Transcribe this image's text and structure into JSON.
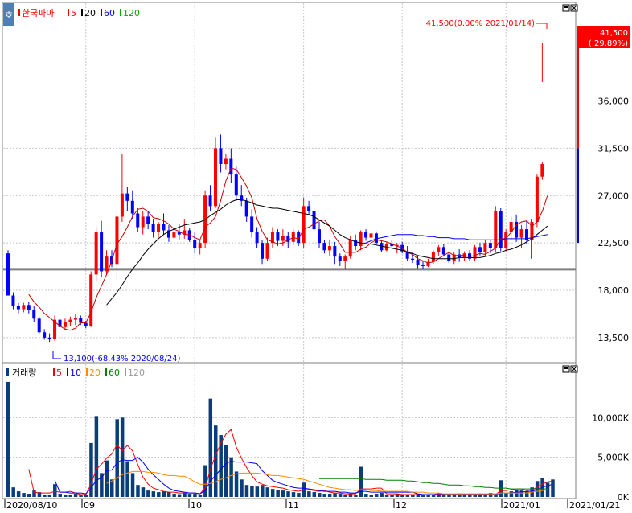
{
  "price_panel": {
    "icon_label": "호",
    "stock_name": "한국파마",
    "ma_labels": [
      {
        "text": "5",
        "color": "#ff0000"
      },
      {
        "text": "20",
        "color": "#000000"
      },
      {
        "text": "60",
        "color": "#0000ff"
      },
      {
        "text": "120",
        "color": "#00aa00"
      }
    ],
    "max_annotation": "41,500(0.00% 2021/01/14)",
    "min_annotation": "13,100(-68.43% 2020/08/24)",
    "current_price": "41,500",
    "current_change": "( 29.89%)",
    "y_ticks": [
      "36,000",
      "31,500",
      "27,000",
      "22,500",
      "18,000",
      "13,500"
    ]
  },
  "volume_panel": {
    "title": "거래량",
    "ma_labels": [
      {
        "text": "5",
        "color": "#ff0000"
      },
      {
        "text": "10",
        "color": "#0000ff"
      },
      {
        "text": "20",
        "color": "#ff8c00"
      },
      {
        "text": "60",
        "color": "#008000"
      },
      {
        "text": "120",
        "color": "#999999"
      }
    ],
    "y_ticks": [
      "10,000K",
      "5,000K",
      "0K"
    ]
  },
  "x_axis": {
    "labels": [
      "2020/08/10",
      "09",
      "10",
      "11",
      "12",
      "2021/01",
      "2021/01/21"
    ]
  },
  "colors": {
    "up": "#ff0000",
    "down": "#0000ff",
    "volume": "#0a3d7a",
    "grid": "#c8c8c8",
    "horizontal_line": "#808080"
  },
  "chart_data": {
    "type": "candlestick",
    "y_range": [
      11500,
      43000
    ],
    "horizontal_line": 20000,
    "candles": [
      [
        21500,
        21800,
        17500,
        17500
      ],
      [
        17500,
        17800,
        16200,
        16500
      ],
      [
        16500,
        16800,
        15800,
        16200
      ],
      [
        16200,
        16800,
        15900,
        16600
      ],
      [
        16600,
        16900,
        15800,
        16100
      ],
      [
        16100,
        16500,
        15000,
        15300
      ],
      [
        15300,
        15500,
        13800,
        14000
      ],
      [
        14000,
        14300,
        13300,
        13500
      ],
      [
        13500,
        13900,
        13100,
        13400
      ],
      [
        13400,
        15600,
        13200,
        15200
      ],
      [
        15200,
        15400,
        14300,
        14500
      ],
      [
        14500,
        15300,
        14200,
        15000
      ],
      [
        15000,
        15500,
        14600,
        15200
      ],
      [
        15200,
        15700,
        14700,
        15400
      ],
      [
        15400,
        15600,
        14700,
        14900
      ],
      [
        14900,
        15100,
        14400,
        14600
      ],
      [
        14600,
        19800,
        14500,
        19500
      ],
      [
        19500,
        24000,
        18800,
        23500
      ],
      [
        23500,
        24600,
        19300,
        19800
      ],
      [
        19800,
        21800,
        19500,
        21200
      ],
      [
        21200,
        21800,
        20200,
        20500
      ],
      [
        20500,
        25500,
        19000,
        25000
      ],
      [
        25000,
        31000,
        24500,
        27200
      ],
      [
        27200,
        27800,
        25500,
        26500
      ],
      [
        26500,
        27500,
        24800,
        25300
      ],
      [
        25300,
        25800,
        23500,
        24000
      ],
      [
        24000,
        25500,
        23300,
        25000
      ],
      [
        25000,
        25500,
        23800,
        24300
      ],
      [
        24300,
        24800,
        23000,
        23500
      ],
      [
        23500,
        24500,
        23000,
        24300
      ],
      [
        24300,
        25300,
        23300,
        23700
      ],
      [
        23700,
        24200,
        22600,
        23000
      ],
      [
        23000,
        24000,
        22800,
        23500
      ],
      [
        23500,
        24300,
        22800,
        23300
      ],
      [
        23300,
        24800,
        22900,
        23700
      ],
      [
        23700,
        23900,
        22600,
        22800
      ],
      [
        22800,
        23500,
        21500,
        22000
      ],
      [
        22000,
        22800,
        21400,
        22500
      ],
      [
        22500,
        27500,
        22000,
        27000
      ],
      [
        27000,
        28000,
        25500,
        26000
      ],
      [
        26000,
        32500,
        25800,
        31500
      ],
      [
        31500,
        32800,
        29200,
        30000
      ],
      [
        30000,
        31000,
        29500,
        30500
      ],
      [
        30500,
        31500,
        28200,
        29000
      ],
      [
        29000,
        29800,
        26500,
        27000
      ],
      [
        27000,
        28000,
        26000,
        26500
      ],
      [
        26500,
        26800,
        24500,
        25000
      ],
      [
        25000,
        25700,
        23000,
        23500
      ],
      [
        23500,
        24000,
        22000,
        22500
      ],
      [
        22500,
        22800,
        20500,
        21000
      ],
      [
        21000,
        23000,
        20800,
        22500
      ],
      [
        22500,
        24000,
        22000,
        23500
      ],
      [
        23500,
        23800,
        22200,
        22700
      ],
      [
        22700,
        23800,
        22200,
        23200
      ],
      [
        23200,
        23500,
        22000,
        22600
      ],
      [
        22600,
        23800,
        22300,
        23500
      ],
      [
        23500,
        23700,
        22200,
        22500
      ],
      [
        22500,
        26800,
        22000,
        26000
      ],
      [
        26000,
        26500,
        25200,
        25500
      ],
      [
        25500,
        25800,
        23500,
        23800
      ],
      [
        23800,
        24500,
        22000,
        22500
      ],
      [
        22500,
        22800,
        21500,
        21800
      ],
      [
        21800,
        22800,
        21300,
        22200
      ],
      [
        22200,
        22600,
        20500,
        21200
      ],
      [
        21200,
        21500,
        20300,
        20800
      ],
      [
        20800,
        21400,
        20000,
        21200
      ],
      [
        21200,
        23200,
        21000,
        22800
      ],
      [
        22800,
        23300,
        21800,
        22200
      ],
      [
        22200,
        23700,
        21800,
        23500
      ],
      [
        23500,
        23800,
        22700,
        23000
      ],
      [
        23000,
        23700,
        22700,
        23400
      ],
      [
        23400,
        23600,
        22300,
        22500
      ],
      [
        22500,
        22700,
        21600,
        21800
      ],
      [
        21800,
        22600,
        21700,
        22400
      ],
      [
        22400,
        22800,
        22000,
        22200
      ],
      [
        22200,
        22500,
        21500,
        22300
      ],
      [
        22300,
        22600,
        21500,
        21700
      ],
      [
        21700,
        22200,
        20800,
        21000
      ],
      [
        21000,
        21600,
        20600,
        20900
      ],
      [
        20900,
        21300,
        20100,
        20400
      ],
      [
        20400,
        20800,
        20000,
        20300
      ],
      [
        20300,
        21000,
        20200,
        20700
      ],
      [
        20700,
        21800,
        20500,
        21600
      ],
      [
        21600,
        22300,
        21300,
        22100
      ],
      [
        22100,
        22400,
        21200,
        21400
      ],
      [
        21400,
        21600,
        20600,
        20800
      ],
      [
        20800,
        21600,
        20500,
        21400
      ],
      [
        21400,
        21900,
        20700,
        21100
      ],
      [
        21100,
        21700,
        20800,
        21500
      ],
      [
        21500,
        21800,
        20800,
        21000
      ],
      [
        21000,
        22300,
        20800,
        22100
      ],
      [
        22100,
        22500,
        21300,
        21600
      ],
      [
        21600,
        22800,
        21200,
        22500
      ],
      [
        22500,
        22800,
        21500,
        22000
      ],
      [
        22000,
        26000,
        21600,
        25500
      ],
      [
        25500,
        25800,
        21700,
        22000
      ],
      [
        22000,
        23800,
        21700,
        23500
      ],
      [
        23500,
        25000,
        22800,
        24500
      ],
      [
        24500,
        25200,
        22600,
        23000
      ],
      [
        23000,
        24200,
        22000,
        23800
      ],
      [
        23800,
        24700,
        22400,
        22800
      ],
      [
        22800,
        24800,
        21000,
        24500
      ],
      [
        24500,
        29000,
        24000,
        28800
      ],
      [
        28800,
        30200,
        28500,
        30000
      ]
    ],
    "last_candle_wick": [
      37800,
      41500
    ],
    "ma5": [
      null,
      null,
      null,
      null,
      17600,
      16900,
      16400,
      15800,
      15400,
      15000,
      14600,
      14300,
      14200,
      14400,
      14900,
      14900,
      15900,
      17300,
      18400,
      19500,
      20800,
      22400,
      23100,
      24000,
      25000,
      25700,
      25800,
      25500,
      24900,
      24800,
      24600,
      24300,
      23800,
      23600,
      23300,
      23300,
      23000,
      22800,
      24000,
      24400,
      25000,
      26500,
      28400,
      29600,
      29500,
      28700,
      27900,
      26800,
      24800,
      23600,
      22800,
      22600,
      22400,
      22500,
      22800,
      23000,
      22900,
      23800,
      24000,
      24300,
      24600,
      24700,
      24100,
      23100,
      22400,
      21600,
      21600,
      21600,
      21900,
      22100,
      22500,
      22800,
      22700,
      22600,
      22400,
      22200,
      22000,
      21600,
      21400,
      21000,
      20800,
      20600,
      20700,
      21000,
      21300,
      21600,
      21300,
      21300,
      21300,
      21200,
      21300,
      21500,
      21400,
      21700,
      22000,
      22900,
      22900,
      23500,
      24200,
      24500,
      24600,
      24100,
      24500,
      25500,
      27000
    ],
    "ma20": [
      null,
      null,
      null,
      null,
      null,
      null,
      null,
      null,
      null,
      null,
      null,
      null,
      null,
      null,
      null,
      null,
      null,
      null,
      null,
      16600,
      17200,
      17800,
      18500,
      19300,
      20000,
      20600,
      21300,
      21900,
      22400,
      22900,
      23300,
      23600,
      23800,
      24000,
      24200,
      24300,
      24400,
      24500,
      24700,
      25100,
      25400,
      25700,
      26100,
      26400,
      26600,
      26600,
      26500,
      26300,
      26100,
      26000,
      25900,
      25800,
      25800,
      25700,
      25600,
      25500,
      25400,
      25300,
      25200,
      25000,
      24700,
      24400,
      24100,
      23700,
      23300,
      23000,
      22800,
      22600,
      22500,
      22400,
      22400,
      22300,
      22200,
      22100,
      22000,
      21900,
      21800,
      21600,
      21500,
      21300,
      21200,
      21100,
      21000,
      21000,
      21000,
      21000,
      21000,
      21100,
      21100,
      21100,
      21100,
      21100,
      21200,
      21300,
      21500,
      21600,
      21800,
      21900,
      22100,
      22300,
      22600,
      22900,
      23300,
      23700,
      24100
    ],
    "ma60": [
      null,
      null,
      null,
      null,
      null,
      null,
      null,
      null,
      null,
      null,
      null,
      null,
      null,
      null,
      null,
      null,
      null,
      null,
      null,
      null,
      null,
      null,
      null,
      null,
      null,
      null,
      null,
      null,
      null,
      null,
      null,
      null,
      null,
      null,
      null,
      null,
      null,
      null,
      null,
      null,
      null,
      null,
      null,
      null,
      null,
      null,
      null,
      null,
      null,
      null,
      null,
      null,
      null,
      null,
      null,
      null,
      null,
      null,
      null,
      null,
      null,
      null,
      null,
      null,
      null,
      null,
      null,
      null,
      22400,
      22500,
      22700,
      22900,
      23000,
      23100,
      23200,
      23300,
      23300,
      23300,
      23300,
      23200,
      23200,
      23100,
      23100,
      23000,
      23000,
      23000,
      22900,
      22900,
      22900,
      22800,
      22800,
      22800,
      22800,
      22800,
      22800,
      22800,
      22900,
      22900,
      22900,
      22900,
      22900,
      23000,
      23100,
      23200,
      23300
    ],
    "volume_range": [
      0,
      15000
    ],
    "volumes": [
      14500,
      1200,
      700,
      500,
      400,
      800,
      600,
      300,
      300,
      1600,
      400,
      300,
      300,
      400,
      200,
      200,
      6800,
      10200,
      3000,
      4600,
      2200,
      9800,
      10000,
      4500,
      3000,
      1500,
      1200,
      800,
      700,
      600,
      700,
      600,
      400,
      350,
      500,
      400,
      400,
      300,
      4000,
      12400,
      9000,
      7800,
      6500,
      5000,
      3200,
      2200,
      1500,
      1400,
      1300,
      1500,
      1200,
      1000,
      900,
      800,
      700,
      600,
      500,
      1800,
      700,
      600,
      500,
      400,
      400,
      500,
      400,
      300,
      400,
      300,
      3800,
      400,
      300,
      400,
      500,
      300,
      300,
      400,
      300,
      300,
      300,
      400,
      300,
      300,
      300,
      500,
      300,
      300,
      300,
      400,
      300,
      400,
      300,
      400,
      300,
      500,
      300,
      2100,
      500,
      700,
      900,
      800,
      700,
      1200,
      2000,
      2400,
      1800,
      2200
    ],
    "vol_ma5": [
      null,
      null,
      null,
      null,
      3500,
      600,
      500,
      500,
      500,
      700,
      600,
      600,
      700,
      500,
      300,
      300,
      1600,
      3500,
      4100,
      4900,
      5400,
      6600,
      5800,
      6500,
      5800,
      4100,
      2500,
      1600,
      1100,
      900,
      700,
      600,
      600,
      500,
      500,
      500,
      500,
      400,
      1100,
      3500,
      5200,
      6700,
      7900,
      8500,
      6300,
      4900,
      3700,
      2700,
      1900,
      1600,
      1400,
      1300,
      1200,
      1100,
      900,
      800,
      700,
      900,
      900,
      800,
      700,
      800,
      600,
      500,
      500,
      400,
      400,
      400,
      1000,
      1000,
      1000,
      1100,
      1100,
      400,
      400,
      400,
      300,
      300,
      300,
      300,
      300,
      300,
      300,
      400,
      300,
      300,
      300,
      400,
      300,
      400,
      300,
      400,
      300,
      400,
      300,
      800,
      800,
      900,
      1000,
      1000,
      800,
      900,
      1200,
      1600,
      1900,
      2000
    ],
    "vol_ma10": [
      null,
      null,
      null,
      null,
      null,
      null,
      null,
      null,
      null,
      2100,
      600,
      600,
      500,
      500,
      500,
      400,
      1100,
      2100,
      2400,
      3300,
      3400,
      4300,
      4700,
      4600,
      4600,
      5000,
      4400,
      3500,
      2800,
      2200,
      1600,
      1100,
      800,
      700,
      600,
      500,
      500,
      400,
      800,
      2000,
      2700,
      3500,
      4200,
      4500,
      4400,
      4400,
      4400,
      4300,
      4200,
      3300,
      2700,
      2100,
      1800,
      1600,
      1400,
      1200,
      1100,
      1100,
      1000,
      900,
      800,
      700,
      700,
      700,
      600,
      600,
      500,
      500,
      700,
      700,
      600,
      600,
      600,
      600,
      600,
      600,
      600,
      600,
      600,
      400,
      300,
      300,
      300,
      300,
      300,
      300,
      300,
      400,
      300,
      300,
      300,
      300,
      300,
      400,
      300,
      500,
      500,
      500,
      600,
      600,
      700,
      700,
      900,
      1200,
      1400,
      1600
    ],
    "vol_ma20": [
      null,
      null,
      null,
      null,
      null,
      null,
      null,
      null,
      null,
      null,
      null,
      null,
      null,
      null,
      null,
      null,
      null,
      null,
      null,
      1700,
      2000,
      2400,
      2800,
      3000,
      3200,
      3200,
      3200,
      3100,
      3100,
      3000,
      2800,
      2700,
      2700,
      2600,
      2600,
      2300,
      1900,
      1600,
      1600,
      1700,
      1900,
      2200,
      2400,
      2700,
      2900,
      3000,
      3000,
      3000,
      3000,
      2900,
      2800,
      2700,
      2700,
      2600,
      2500,
      2400,
      2300,
      2200,
      2000,
      1800,
      1600,
      1400,
      1200,
      1100,
      1000,
      900,
      900,
      800,
      900,
      900,
      800,
      800,
      700,
      700,
      700,
      700,
      700,
      700,
      600,
      600,
      600,
      500,
      500,
      500,
      400,
      400,
      400,
      400,
      400,
      400,
      400,
      400,
      400,
      400,
      400,
      500,
      500,
      500,
      500,
      500,
      500,
      600,
      700,
      800,
      900
    ],
    "vol_ma60": [
      null,
      null,
      null,
      null,
      null,
      null,
      null,
      null,
      null,
      null,
      null,
      null,
      null,
      null,
      null,
      null,
      null,
      null,
      null,
      null,
      null,
      null,
      null,
      null,
      null,
      null,
      null,
      null,
      null,
      null,
      null,
      null,
      null,
      null,
      null,
      null,
      null,
      null,
      null,
      null,
      null,
      null,
      null,
      null,
      null,
      null,
      null,
      null,
      null,
      null,
      null,
      null,
      null,
      null,
      null,
      null,
      null,
      null,
      null,
      null,
      2300,
      2300,
      2300,
      2300,
      2300,
      2300,
      2300,
      2300,
      2300,
      2200,
      2200,
      2200,
      2200,
      2100,
      2100,
      2100,
      2100,
      2000,
      2000,
      1900,
      1800,
      1800,
      1700,
      1700,
      1600,
      1500,
      1500,
      1500,
      1400,
      1400,
      1300,
      1300,
      1200,
      1200,
      1100,
      1100,
      1100,
      1000,
      1000,
      1000,
      1000,
      1000,
      1000,
      1000,
      1000
    ]
  }
}
